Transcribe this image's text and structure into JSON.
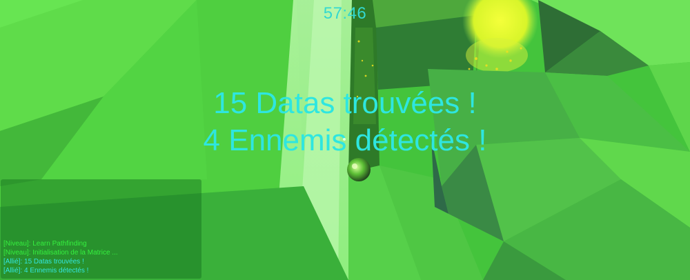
{
  "hud": {
    "timer": "57:46",
    "announcements": [
      "15 Datas trouvées !",
      "4 Ennemis détectés !"
    ]
  },
  "log": {
    "lines": [
      {
        "text": "[Niveau]: Learn Pathfinding",
        "type": "level"
      },
      {
        "text": "[Niveau]: Initialisation de la Matrice ...",
        "type": "level"
      },
      {
        "text": "[Allié]: 15 Datas trouvées !",
        "type": "ally"
      },
      {
        "text": "[Allié]: 4 Ennemis détectés !",
        "type": "ally"
      }
    ]
  },
  "colors": {
    "hud_text": "#2ee6e0",
    "level_log": "#35f03f",
    "ally_log": "#34e6e0",
    "scene_green": "#3fbf3a"
  }
}
